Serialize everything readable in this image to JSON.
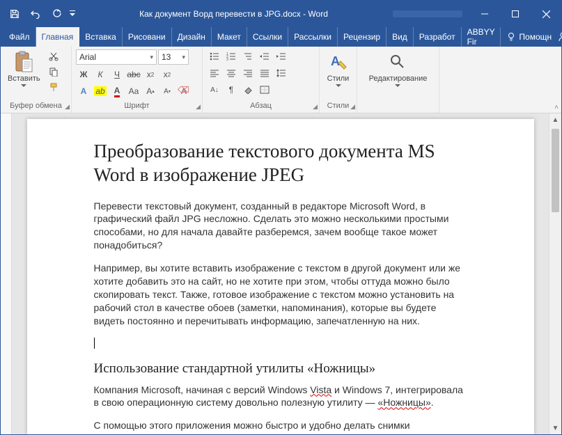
{
  "titlebar": {
    "title": "Как документ Ворд перевести в JPG.docx  -  Word"
  },
  "tabs": {
    "file": "Файл",
    "home": "Главная",
    "insert": "Вставка",
    "draw": "Рисовани",
    "design": "Дизайн",
    "layout": "Макет",
    "references": "Ссылки",
    "mailings": "Рассылки",
    "review": "Рецензир",
    "view": "Вид",
    "developer": "Разработ",
    "abbyy": "ABBYY Fir",
    "tellme": "Помощн"
  },
  "ribbon": {
    "clipboard": {
      "paste": "Вставить",
      "label": "Буфер обмена"
    },
    "font": {
      "name": "Arial",
      "size": "13",
      "label": "Шрифт",
      "bold": "Ж",
      "italic": "К",
      "underline": "Ч"
    },
    "paragraph": {
      "label": "Абзац"
    },
    "styles": {
      "btn": "Стили",
      "label": "Стили"
    },
    "editing": {
      "btn": "Редактирование"
    }
  },
  "document": {
    "h1": "Преобразование текстового документа MS Word в изображение JPEG",
    "p1": "Перевести текстовый документ, созданный в редакторе Microsoft Word, в графический файл JPG несложно. Сделать это можно несколькими простыми способами, но для начала давайте разберемся, зачем вообще такое может понадобиться?",
    "p2": "Например, вы хотите вставить изображение с текстом в другой документ или же хотите добавить это на сайт, но не хотите при этом, чтобы оттуда можно было скопировать текст. Также, готовое изображение с текстом можно установить на рабочий стол в качестве обоев (заметки, напоминания), которые вы будете видеть постоянно и перечитывать информацию, запечатленную на них.",
    "h2": "Использование стандартной утилиты «Ножницы»",
    "p3_a": "Компания Microsoft, начиная с версий Windows ",
    "p3_vista": "Vista",
    "p3_b": " и Windows 7, интегрировала в свою операционную систему довольно полезную утилиту — ",
    "p3_snip": "«Ножницы»",
    "p3_c": ".",
    "p4": "С помощью этого приложения можно быстро и удобно делать снимки"
  }
}
